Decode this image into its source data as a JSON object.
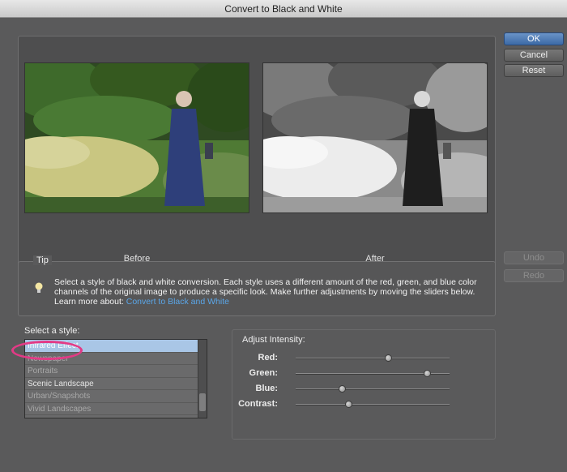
{
  "window": {
    "title": "Convert to Black and White"
  },
  "buttons": {
    "ok": "OK",
    "cancel": "Cancel",
    "reset": "Reset",
    "undo": "Undo",
    "redo": "Redo"
  },
  "preview": {
    "before_label": "Before",
    "after_label": "After"
  },
  "tip": {
    "label": "Tip",
    "text": "Select a style of black and white conversion. Each style uses a different amount of the red, green, and blue color channels of the original image to produce a specific look. Make further adjustments by moving the sliders below. Learn more about: ",
    "link": "Convert to Black and White"
  },
  "styles": {
    "label": "Select a style:",
    "items": [
      "Infrared Effect",
      "Newspaper",
      "Portraits",
      "Scenic Landscape",
      "Urban/Snapshots",
      "Vivid Landscapes"
    ],
    "selected": "Infrared Effect"
  },
  "adjust": {
    "label": "Adjust Intensity:",
    "sliders": [
      {
        "name": "Red:",
        "value": 0.6
      },
      {
        "name": "Green:",
        "value": 0.85
      },
      {
        "name": "Blue:",
        "value": 0.3
      },
      {
        "name": "Contrast:",
        "value": 0.34
      }
    ]
  },
  "colors": {
    "accent": "#3c6aa6",
    "selection": "#a9c6e6",
    "highlight": "#e33a86",
    "link": "#5aa6e8"
  }
}
